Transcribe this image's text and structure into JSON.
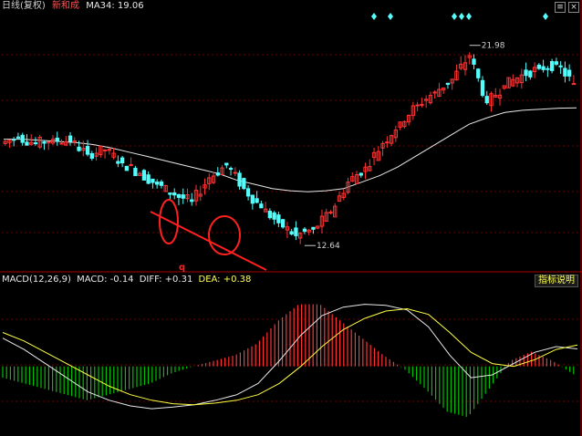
{
  "header": {
    "period_label": "日线(复权)",
    "stock_name": "新和成",
    "ma_label": "MA34: 19.06"
  },
  "macd_header": {
    "label": "MACD(12,26,9)",
    "macd": "MACD: -0.14",
    "diff": "DIFF: +0.31",
    "dea": "DEA: +0.38"
  },
  "indicator_button": "指标说明",
  "window_buttons": [
    "≡",
    "×"
  ],
  "annotations": {
    "high_label": "21.98",
    "low_label": "12.64",
    "marker_q": "q"
  },
  "colors": {
    "up": "#ff3232",
    "down": "#54fcfc",
    "ma": "#e8e8e8",
    "diff": "#e8e8e8",
    "dea": "#ffff40",
    "macd_pos": "#ff3232",
    "macd_neg": "#00c000",
    "grid": "#8b0000",
    "circle": "#ff2020",
    "diamond": "#54fcfc"
  },
  "chart_data": [
    {
      "type": "candlestick",
      "series": [
        {
          "name": "MA34",
          "values": [
            17.6,
            17.6,
            17.55,
            17.5,
            17.45,
            17.35,
            17.2,
            17.0,
            16.8,
            16.6,
            16.4,
            16.2,
            16.0,
            15.7,
            15.5,
            15.3,
            15.2,
            15.15,
            15.2,
            15.3,
            15.6,
            15.9,
            16.3,
            16.8,
            17.3,
            17.8,
            18.3,
            18.6,
            18.85,
            18.95,
            19.0,
            19.05,
            19.06
          ]
        }
      ],
      "ohlc_samples": [
        [
          17.4,
          17.9,
          17.2,
          17.7
        ],
        [
          17.7,
          17.9,
          17.3,
          17.4
        ],
        [
          17.4,
          17.8,
          17.1,
          17.6
        ],
        [
          17.6,
          18.0,
          17.3,
          17.5
        ],
        [
          17.5,
          17.7,
          16.8,
          16.9
        ],
        [
          16.9,
          17.3,
          16.6,
          17.1
        ],
        [
          17.1,
          17.2,
          16.3,
          16.5
        ],
        [
          16.5,
          16.8,
          15.9,
          16.0
        ],
        [
          16.0,
          16.4,
          15.3,
          15.5
        ],
        [
          15.5,
          15.9,
          14.8,
          15.0
        ],
        [
          15.0,
          15.3,
          14.5,
          14.7
        ],
        [
          14.7,
          16.0,
          14.5,
          15.8
        ],
        [
          15.8,
          16.8,
          15.5,
          16.4
        ],
        [
          16.4,
          16.6,
          15.2,
          15.3
        ],
        [
          15.3,
          15.5,
          14.2,
          14.4
        ],
        [
          14.4,
          14.7,
          13.5,
          13.7
        ],
        [
          13.7,
          14.2,
          12.9,
          13.1
        ],
        [
          13.1,
          13.5,
          12.64,
          13.4
        ],
        [
          13.4,
          14.4,
          13.2,
          14.2
        ],
        [
          14.2,
          15.8,
          14.0,
          15.6
        ],
        [
          15.6,
          16.5,
          15.4,
          16.3
        ],
        [
          16.3,
          17.6,
          16.1,
          17.4
        ],
        [
          17.4,
          18.6,
          17.2,
          18.4
        ],
        [
          18.4,
          19.5,
          18.1,
          19.2
        ],
        [
          19.2,
          20.1,
          18.8,
          19.8
        ],
        [
          19.8,
          20.8,
          19.5,
          20.4
        ],
        [
          20.4,
          21.98,
          20.1,
          21.5
        ],
        [
          21.5,
          21.7,
          19.0,
          19.3
        ],
        [
          19.3,
          20.4,
          18.6,
          20.1
        ],
        [
          20.1,
          20.9,
          19.8,
          20.6
        ],
        [
          20.6,
          21.2,
          20.0,
          20.9
        ],
        [
          20.9,
          21.4,
          20.5,
          21.1
        ],
        [
          21.1,
          21.3,
          19.8,
          20.2
        ]
      ],
      "high_point": 21.98,
      "low_point": 12.64
    },
    {
      "type": "bar",
      "title": "MACD(12,26,9)",
      "series": [
        {
          "name": "DIFF",
          "values": [
            0.5,
            0.3,
            0.05,
            -0.2,
            -0.45,
            -0.6,
            -0.7,
            -0.75,
            -0.72,
            -0.68,
            -0.6,
            -0.5,
            -0.3,
            0.1,
            0.55,
            0.9,
            1.05,
            1.1,
            1.08,
            1.0,
            0.7,
            0.2,
            -0.2,
            -0.15,
            0.05,
            0.25,
            0.35,
            0.31
          ]
        },
        {
          "name": "DEA",
          "values": [
            0.6,
            0.45,
            0.25,
            0.05,
            -0.15,
            -0.35,
            -0.5,
            -0.6,
            -0.66,
            -0.68,
            -0.65,
            -0.6,
            -0.5,
            -0.3,
            0.0,
            0.35,
            0.65,
            0.85,
            0.98,
            1.02,
            0.92,
            0.6,
            0.25,
            0.05,
            0.0,
            0.12,
            0.3,
            0.38
          ]
        },
        {
          "name": "MACD",
          "values": [
            -0.2,
            -0.3,
            -0.4,
            -0.5,
            -0.6,
            -0.5,
            -0.4,
            -0.3,
            -0.12,
            0.0,
            0.1,
            0.2,
            0.4,
            0.8,
            1.1,
            1.1,
            0.8,
            0.5,
            0.2,
            -0.05,
            -0.4,
            -0.8,
            -0.9,
            -0.4,
            0.1,
            0.26,
            0.1,
            -0.14
          ]
        }
      ]
    }
  ]
}
